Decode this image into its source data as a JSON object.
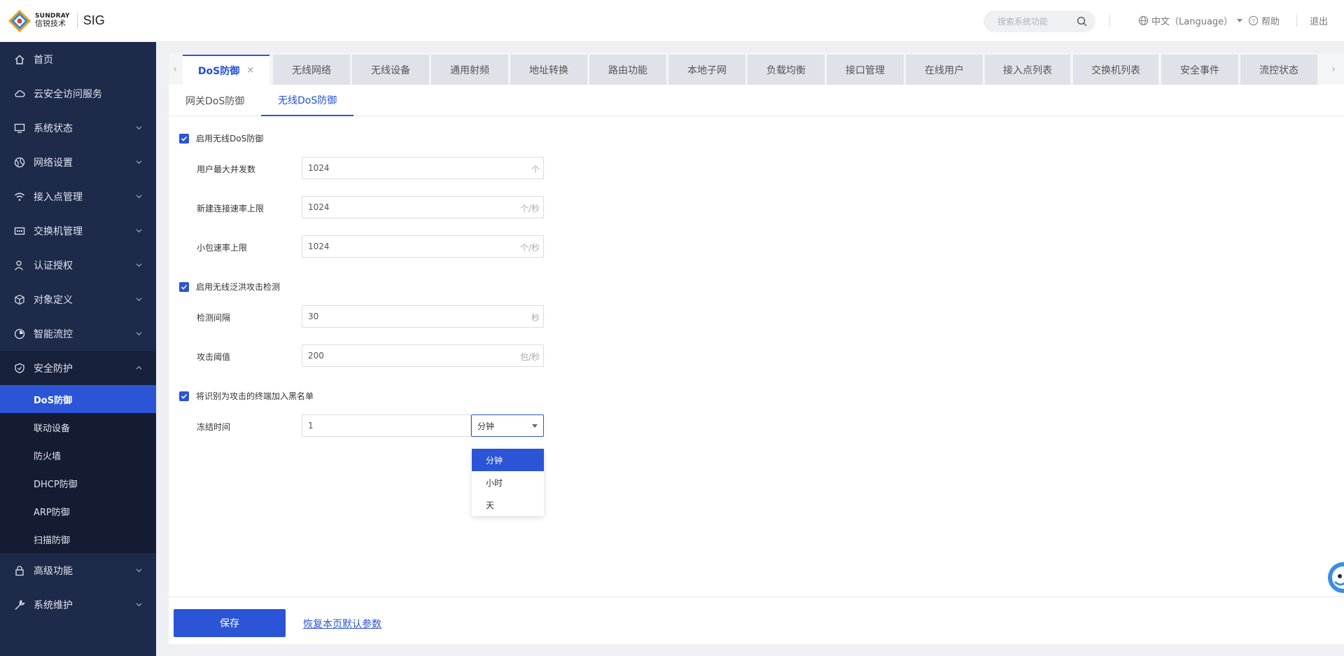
{
  "brand": {
    "name_en": "SUNDRAY",
    "name_cn": "信锐技术",
    "product": "SIG"
  },
  "header": {
    "search_placeholder": "搜索系统功能",
    "language": "中文（Language）",
    "help": "帮助",
    "logout": "退出"
  },
  "sidebar": {
    "items": [
      {
        "label": "首页",
        "icon": "home-icon"
      },
      {
        "label": "云安全访问服务",
        "icon": "cloud-icon"
      },
      {
        "label": "系统状态",
        "icon": "monitor-icon"
      },
      {
        "label": "网络设置",
        "icon": "globe-icon"
      },
      {
        "label": "接入点管理",
        "icon": "wifi-icon"
      },
      {
        "label": "交换机管理",
        "icon": "switch-icon"
      },
      {
        "label": "认证授权",
        "icon": "user-icon"
      },
      {
        "label": "对象定义",
        "icon": "cube-icon"
      },
      {
        "label": "智能流控",
        "icon": "flow-icon"
      },
      {
        "label": "安全防护",
        "icon": "shield-icon"
      },
      {
        "label": "高级功能",
        "icon": "lock-icon"
      },
      {
        "label": "系统维护",
        "icon": "wrench-icon"
      }
    ],
    "security_sub": [
      "DoS防御",
      "联动设备",
      "防火墙",
      "DHCP防御",
      "ARP防御",
      "扫描防御"
    ]
  },
  "tabs": [
    "DoS防御",
    "无线网络",
    "无线设备",
    "通用射频",
    "地址转换",
    "路由功能",
    "本地子网",
    "负载均衡",
    "接口管理",
    "在线用户",
    "接入点列表",
    "交换机列表",
    "安全事件",
    "流控状态"
  ],
  "subtabs": [
    "网关DoS防御",
    "无线DoS防御"
  ],
  "form": {
    "enable_wireless_dos": "启用无线DoS防御",
    "max_concurrent": {
      "label": "用户最大并发数",
      "value": "1024",
      "unit": "个"
    },
    "new_conn_rate": {
      "label": "新建连接速率上限",
      "value": "1024",
      "unit": "个/秒"
    },
    "small_pkt_rate": {
      "label": "小包速率上限",
      "value": "1024",
      "unit": "个/秒"
    },
    "enable_flood_detect": "启用无线泛洪攻击检测",
    "detect_interval": {
      "label": "检测间隔",
      "value": "30",
      "unit": "秒"
    },
    "attack_threshold": {
      "label": "攻击阈值",
      "value": "200",
      "unit": "包/秒"
    },
    "blacklist_attackers": "将识别为攻击的终端加入黑名单",
    "freeze_time": {
      "label": "冻结时间",
      "value": "1",
      "unit_selected": "分钟"
    },
    "unit_options": [
      "分钟",
      "小时",
      "天"
    ]
  },
  "footer": {
    "save": "保存",
    "restore": "恢复本页默认参数"
  },
  "colors": {
    "accent": "#2b55d6",
    "sidebar_bg": "#1e2a4a"
  }
}
